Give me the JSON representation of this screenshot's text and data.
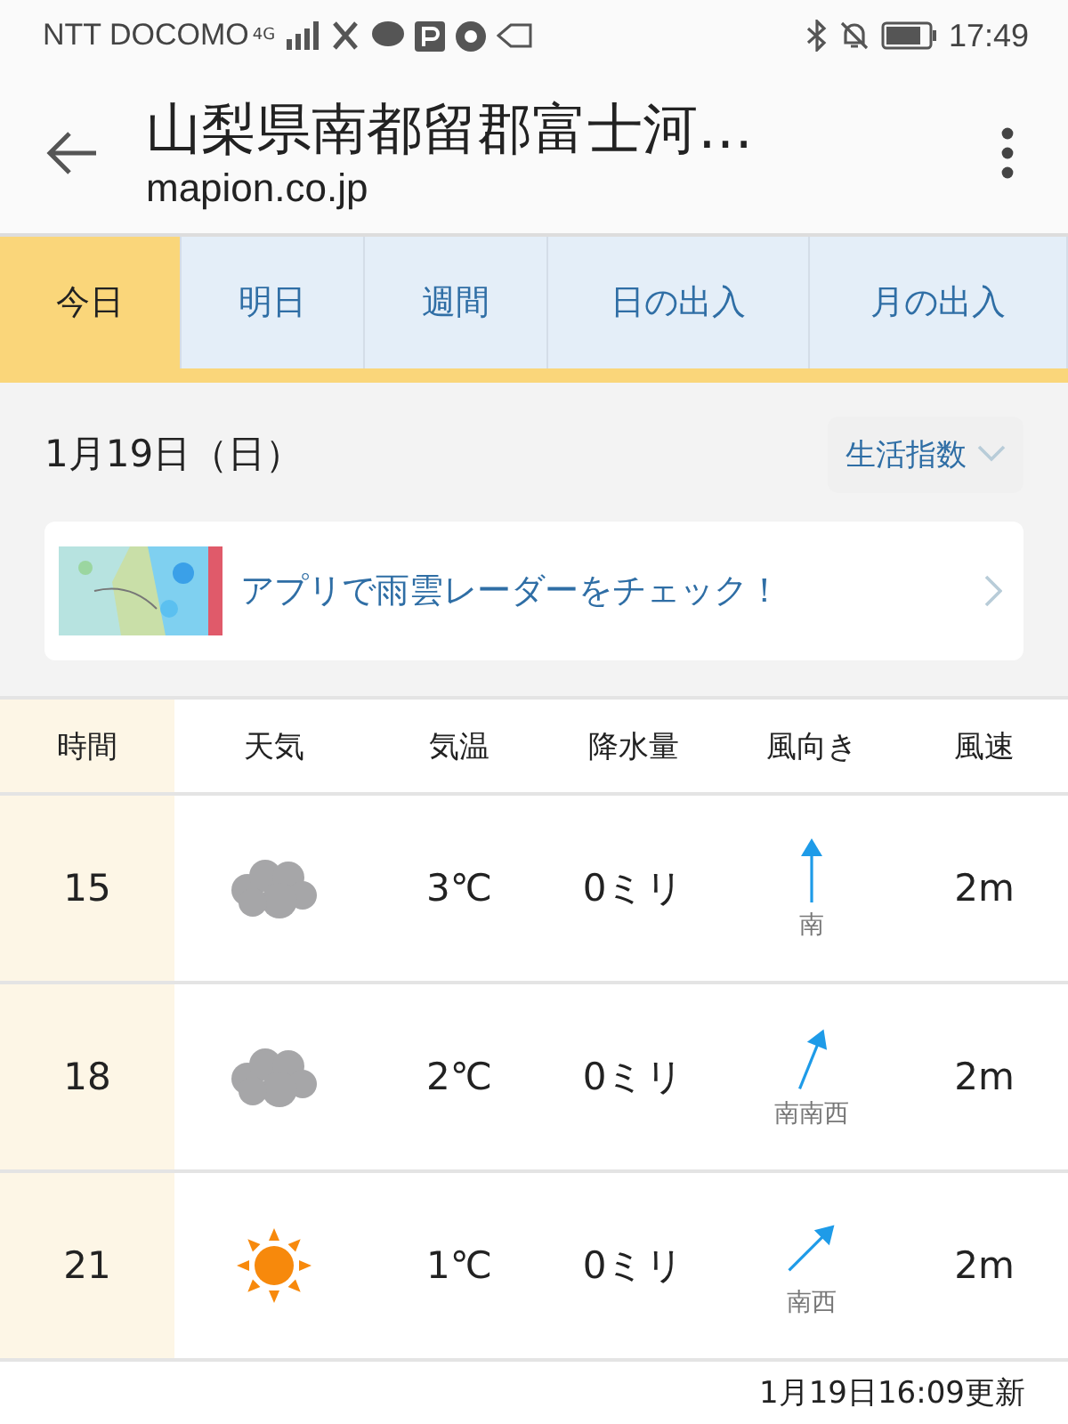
{
  "status_bar": {
    "carrier": "NTT DOCOMO",
    "network": "4G",
    "time": "17:49"
  },
  "header": {
    "title": "山梨県南都留郡富士河…",
    "domain": "mapion.co.jp"
  },
  "tabs": [
    {
      "label": "今日",
      "selected": true
    },
    {
      "label": "明日",
      "selected": false
    },
    {
      "label": "週間",
      "selected": false
    },
    {
      "label": "日の出入",
      "selected": false
    },
    {
      "label": "月の出入",
      "selected": false
    }
  ],
  "date": "1月19日（日）",
  "life_index_button": "生活指数",
  "banner": {
    "text": "アプリで雨雲レーダーをチェック！"
  },
  "table": {
    "columns": [
      "時間",
      "天気",
      "気温",
      "降水量",
      "風向き",
      "風速"
    ],
    "rows": [
      {
        "time": "15",
        "kind": "cloudy",
        "temp": "3℃",
        "rain": "0ミリ",
        "wind": {
          "kind": "s",
          "direction": "南"
        },
        "wind_speed": "2m"
      },
      {
        "time": "18",
        "kind": "cloudy",
        "temp": "2℃",
        "rain": "0ミリ",
        "wind": {
          "kind": "ssw",
          "direction": "南南西"
        },
        "wind_speed": "2m"
      },
      {
        "time": "21",
        "kind": "sunny",
        "temp": "1℃",
        "rain": "0ミリ",
        "wind": {
          "kind": "sw",
          "direction": "南西"
        },
        "wind_speed": "2m"
      }
    ]
  },
  "updated": "1月19日16:09更新"
}
